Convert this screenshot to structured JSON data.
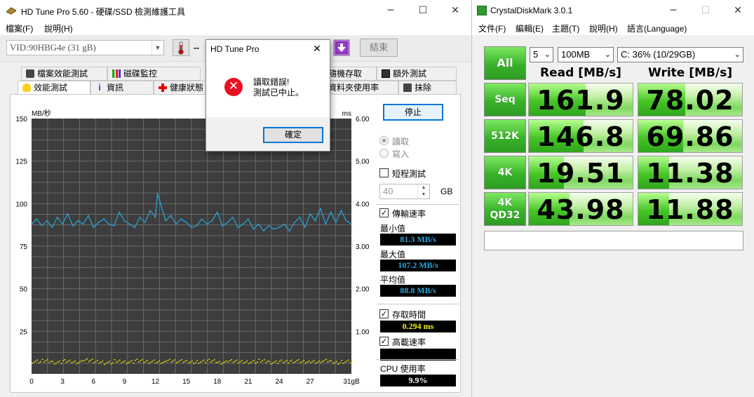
{
  "hdtune": {
    "title": "HD Tune Pro 5.60 - 硬碟/SSD 檢測維護工具",
    "menu": [
      "檔案(F)",
      "說明(H)"
    ],
    "drive": "VID:90HBG4e (31 gB)",
    "temp": "--",
    "exit_label": "結束",
    "tabs_top": [
      "檔案效能測試",
      "磁碟監控",
      "隨機存取",
      "額外測試"
    ],
    "tabs_bottom": [
      "效能測試",
      "資訊",
      "健康狀態",
      "資料夾使用率",
      "抹除"
    ],
    "stop_label": "停止",
    "read_label": "讀取",
    "write_label": "寫入",
    "short_test_label": "短程測試",
    "short_test_value": "40",
    "gb_label": "GB",
    "transfer_rate_label": "傳輸速率",
    "min_label": "最小值",
    "min_value": "81.3 MB/s",
    "max_label": "最大值",
    "max_value": "107.2 MB/s",
    "avg_label": "平均值",
    "avg_value": "88.8 MB/s",
    "access_time_label": "存取時間",
    "access_time_value": "0.294 ms",
    "burst_rate_label": "高載速率",
    "burst_rate_value": "",
    "cpu_label": "CPU 使用率",
    "cpu_value": "9.9%",
    "colors": {
      "transfer": "#27a8e0",
      "access": "#f2f200",
      "min_max_avg": "#27a8e0",
      "access_val": "#f2f200",
      "cpu_val": "#ffffff"
    }
  },
  "chart_data": {
    "type": "line",
    "xlabel": "",
    "x_ticks": [
      "0",
      "3",
      "6",
      "9",
      "12",
      "15",
      "18",
      "21",
      "24",
      "27",
      "31gB"
    ],
    "y_left_unit": "MB/秒",
    "y_left_ticks": [
      "150",
      "125",
      "100",
      "75",
      "50",
      "25"
    ],
    "y_right_unit": "ms",
    "y_right_ticks": [
      "6.00",
      "5.00",
      "4.00",
      "3.00",
      "2.00",
      "1.00"
    ],
    "xlim": [
      0,
      31
    ],
    "ylim_left": [
      0,
      150
    ],
    "ylim_right": [
      0,
      6
    ],
    "grid": true,
    "series": [
      {
        "x": [
          0,
          0.5,
          1,
          1.5,
          2,
          2.5,
          3,
          3.5,
          4,
          4.5,
          5,
          5.5,
          6,
          6.5,
          7,
          7.5,
          8,
          8.5,
          9,
          9.5,
          10,
          10.5,
          11,
          11.5,
          12,
          12.2,
          12.5,
          13,
          13.5,
          14,
          14.5,
          15,
          15.5,
          16,
          16.5,
          17,
          17.5,
          18,
          18.5,
          19,
          19.5,
          20,
          20.5,
          21,
          21.5,
          22,
          22.5,
          23,
          23.5,
          24,
          24.5,
          25,
          25.5,
          26,
          26.5,
          27,
          27.5,
          28,
          28.5,
          29,
          29.5,
          30,
          30.5,
          31
        ],
        "values": [
          88,
          91,
          87,
          90,
          86,
          92,
          88,
          94,
          87,
          90,
          88,
          93,
          86,
          89,
          91,
          88,
          87,
          95,
          90,
          88,
          86,
          92,
          89,
          96,
          92,
          106,
          100,
          90,
          93,
          88,
          91,
          89,
          86,
          87,
          91,
          88,
          90,
          95,
          87,
          89,
          92,
          86,
          88,
          91,
          85,
          88,
          84,
          87,
          85,
          86,
          88,
          84,
          89,
          92,
          86,
          94,
          90,
          97,
          88,
          95,
          89,
          96,
          90,
          88
        ]
      },
      {
        "x": [
          0,
          1,
          2,
          3,
          4,
          5,
          6,
          7,
          8,
          9,
          10,
          11,
          12,
          13,
          14,
          15,
          16,
          17,
          18,
          19,
          20,
          21,
          22,
          23,
          24,
          25,
          26,
          27,
          28,
          29,
          30,
          31
        ],
        "values": [
          0.3,
          0.32,
          0.28,
          0.31,
          0.29,
          0.33,
          0.3,
          0.27,
          0.31,
          0.29,
          0.32,
          0.3,
          0.28,
          0.33,
          0.31,
          0.29,
          0.3,
          0.32,
          0.28,
          0.31,
          0.3,
          0.29,
          0.32,
          0.28,
          0.3,
          0.31,
          0.29,
          0.3,
          0.32,
          0.28,
          0.3,
          0.29
        ]
      }
    ]
  },
  "dialog": {
    "title": "HD Tune Pro",
    "message_line1": "讀取錯誤!",
    "message_line2": "測試已中止。",
    "ok_label": "確定"
  },
  "cdm": {
    "title": "CrystalDiskMark 3.0.1",
    "menu": [
      "文件(F)",
      "編輯(E)",
      "主題(T)",
      "說明(H)",
      "語言(Language)"
    ],
    "all_label": "All",
    "runs": "5",
    "size": "100MB",
    "drive": "C: 36% (10/29GB)",
    "read_header": "Read [MB/s]",
    "write_header": "Write [MB/s]",
    "rows": [
      {
        "label": "Seq",
        "read": "161.9",
        "write": "78.02",
        "read_frac": 0.55,
        "write_frac": 0.45
      },
      {
        "label": "512K",
        "read": "146.8",
        "write": "69.86",
        "read_frac": 0.53,
        "write_frac": 0.43
      },
      {
        "label": "4K",
        "read": "19.51",
        "write": "11.38",
        "read_frac": 0.34,
        "write_frac": 0.3
      },
      {
        "label_line1": "4K",
        "label_line2": "QD32",
        "read": "43.98",
        "write": "11.88",
        "read_frac": 0.39,
        "write_frac": 0.3
      }
    ],
    "comment": ""
  }
}
